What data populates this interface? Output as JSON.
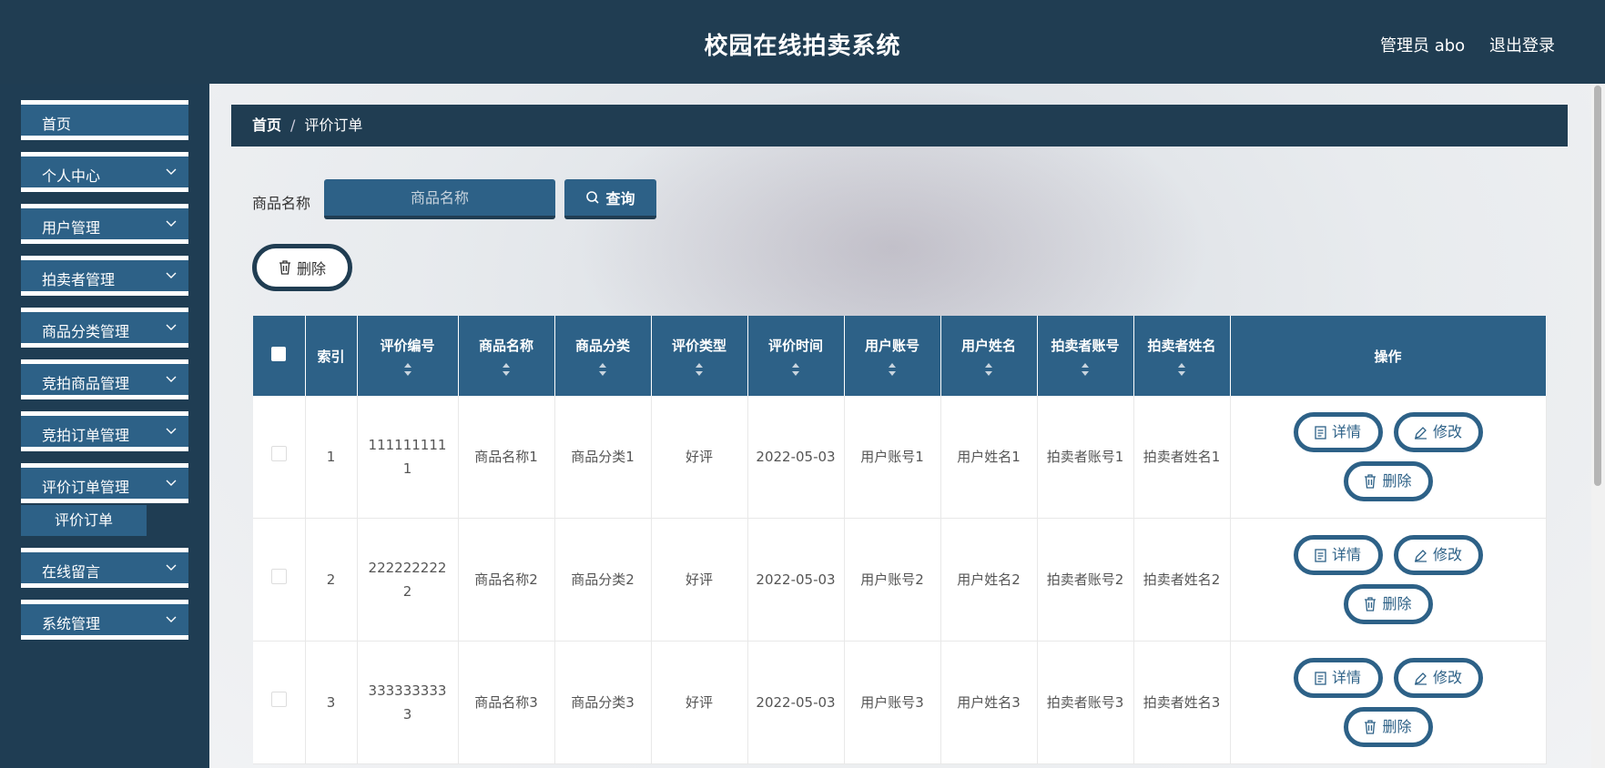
{
  "header": {
    "title": "校园在线拍卖系统",
    "user": "管理员 abo",
    "logout": "退出登录"
  },
  "sidebar": {
    "items": [
      {
        "label": "首页",
        "chevron": false
      },
      {
        "label": "个人中心",
        "chevron": true
      },
      {
        "label": "用户管理",
        "chevron": true
      },
      {
        "label": "拍卖者管理",
        "chevron": true
      },
      {
        "label": "商品分类管理",
        "chevron": true
      },
      {
        "label": "竞拍商品管理",
        "chevron": true
      },
      {
        "label": "竞拍订单管理",
        "chevron": true
      },
      {
        "label": "评价订单管理",
        "chevron": true
      },
      {
        "label": "在线留言",
        "chevron": true
      },
      {
        "label": "系统管理",
        "chevron": true
      }
    ],
    "sub_item": "评价订单"
  },
  "breadcrumb": {
    "home": "首页",
    "sep": "/",
    "current": "评价订单"
  },
  "search": {
    "label": "商品名称",
    "placeholder": "商品名称",
    "button": "查询"
  },
  "toolbar": {
    "delete": "删除"
  },
  "table": {
    "columns": [
      "索引",
      "评价编号",
      "商品名称",
      "商品分类",
      "评价类型",
      "评价时间",
      "用户账号",
      "用户姓名",
      "拍卖者账号",
      "拍卖者姓名",
      "操作"
    ],
    "rows": [
      {
        "index": "1",
        "code": "1111111111",
        "goods": "商品名称1",
        "category": "商品分类1",
        "type": "好评",
        "time": "2022-05-03",
        "account": "用户账号1",
        "name": "用户姓名1",
        "seller_account": "拍卖者账号1",
        "seller_name": "拍卖者姓名1"
      },
      {
        "index": "2",
        "code": "2222222222",
        "goods": "商品名称2",
        "category": "商品分类2",
        "type": "好评",
        "time": "2022-05-03",
        "account": "用户账号2",
        "name": "用户姓名2",
        "seller_account": "拍卖者账号2",
        "seller_name": "拍卖者姓名2"
      },
      {
        "index": "3",
        "code": "3333333333",
        "goods": "商品名称3",
        "category": "商品分类3",
        "type": "好评",
        "time": "2022-05-03",
        "account": "用户账号3",
        "name": "用户姓名3",
        "seller_account": "拍卖者账号3",
        "seller_name": "拍卖者姓名3"
      }
    ],
    "actions": {
      "detail": "详情",
      "edit": "修改",
      "delete": "删除"
    }
  },
  "colors": {
    "primary": "#2d6187",
    "dark": "#203d52"
  }
}
